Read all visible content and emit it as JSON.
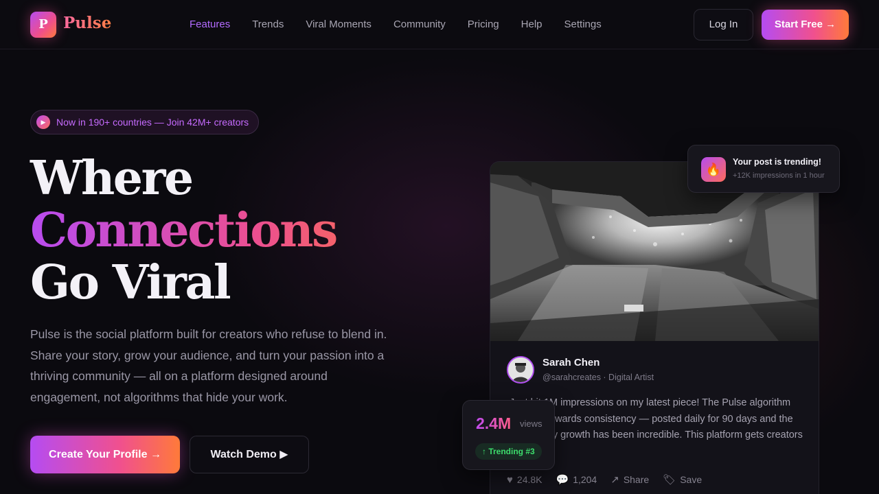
{
  "brand": {
    "logo_letter": "P",
    "name": "Pulse"
  },
  "nav": {
    "links": [
      "Features",
      "Trends",
      "Viral Moments",
      "Community",
      "Pricing",
      "Help",
      "Settings"
    ],
    "active": "Features",
    "login_label": "Log In",
    "start_label": "Start Free →"
  },
  "hero": {
    "badge_text": "Now in 190+ countries — Join 42M+ creators",
    "headline_line1": "Where",
    "headline_line2": "Connections",
    "headline_line3": "Go Viral",
    "description": "Pulse is the social platform built for creators who refuse to blend in. Share your story, grow your audience, and turn your passion into a thriving community — all on a platform designed around engagement, not algorithms that hide your work.",
    "cta_primary": "Create Your Profile →",
    "cta_secondary": "Watch Demo ▶"
  },
  "post": {
    "author_name": "Sarah Chen",
    "author_handle": "@sarahcreates · Digital Artist",
    "text": "Just hit 1M impressions on my latest piece! The Pulse algorithm actually rewards consistency — posted daily for 90 days and the community growth has been incredible. This platform gets creators 🎨✨",
    "likes": "24.8K",
    "comments": "1,204",
    "share_label": "Share",
    "save_label": "Save"
  },
  "stats": {
    "views_number": "2.4M",
    "views_label": "views",
    "trending_badge": "↑ Trending #3"
  },
  "toast": {
    "title": "Your post is trending!",
    "subtitle": "+12K impressions in 1 hour"
  },
  "colors": {
    "accent_purple": "#b54cf2",
    "accent_pink": "#f0508e",
    "accent_orange": "#ff7a3a",
    "background": "#0b0a0f",
    "trending_green": "#3ddc6c"
  }
}
